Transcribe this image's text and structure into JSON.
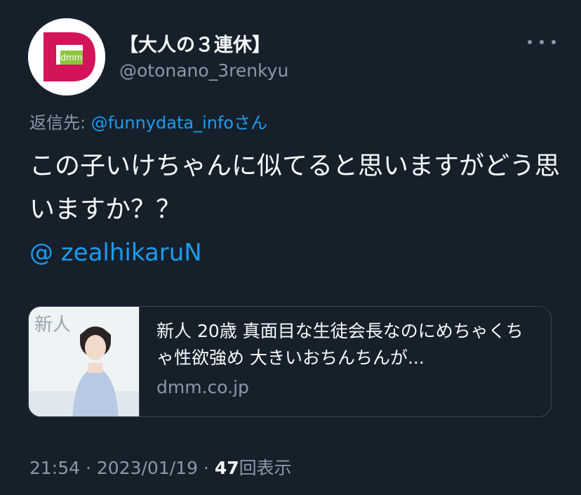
{
  "author": {
    "display_name": "【大人の３連休】",
    "handle": "@otonano_3renkyu",
    "avatar_text": "dmm",
    "avatar_icon": "dmm-logo"
  },
  "reply": {
    "prefix": "返信先: ",
    "mention": "@funnydata_info",
    "suffix": "さん"
  },
  "tweet": {
    "text": "この子いけちゃんに似てると思いますがどう思いますか？？",
    "mention": "@ zealhikaruN"
  },
  "link_card": {
    "title": "新人 20歳 真面目な生徒会長なのにめちゃくちゃ性欲強め 大きいおちんちんが...",
    "domain": "dmm.co.jp",
    "thumb_label": "新人"
  },
  "meta": {
    "time": "21:54",
    "sep1": " · ",
    "date": "2023/01/19",
    "sep2": " · ",
    "views_count": "47",
    "views_label": "回表示"
  },
  "colors": {
    "background": "#15202b",
    "accent": "#1d9bf0",
    "secondary_text": "#8b98a5",
    "avatar_magenta": "#d4145a",
    "avatar_green": "#8cc63f"
  }
}
